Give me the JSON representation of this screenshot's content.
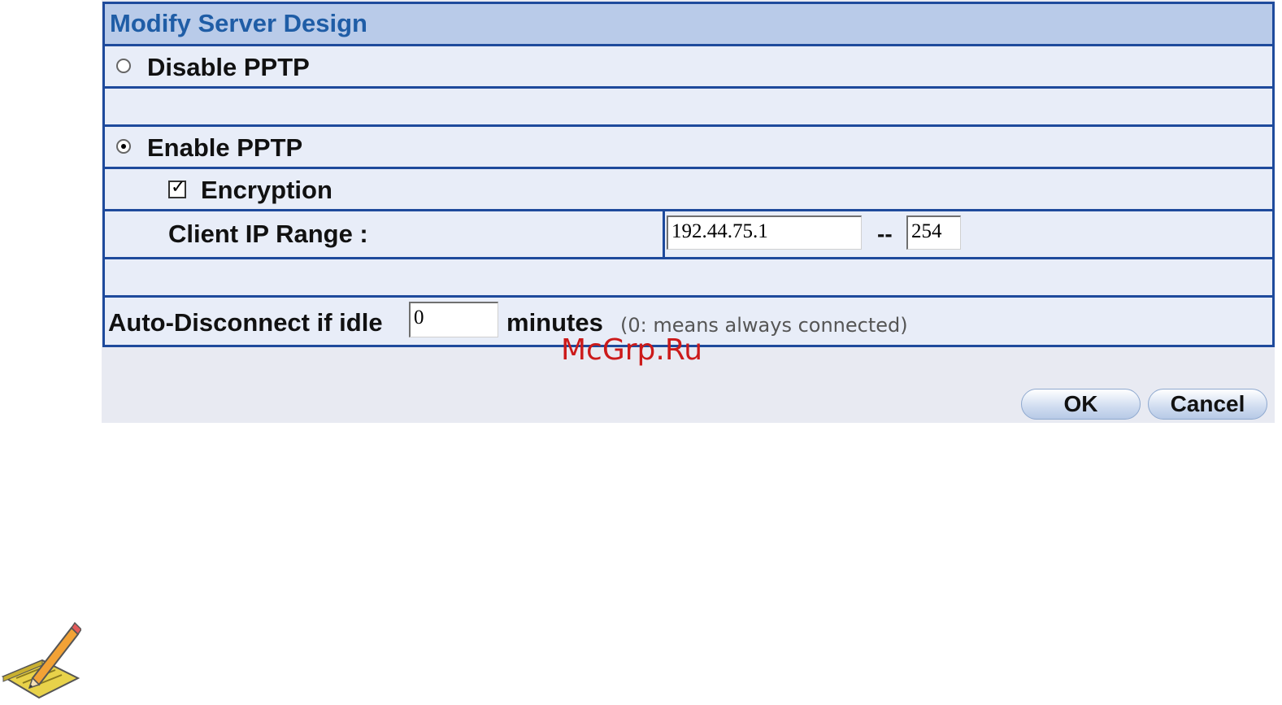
{
  "form": {
    "title": "Modify Server Design",
    "disable_pptp": {
      "label": "Disable PPTP",
      "selected": false
    },
    "enable_pptp": {
      "label": "Enable PPTP",
      "selected": true
    },
    "encryption": {
      "label": "Encryption",
      "checked": true
    },
    "client_ip_range": {
      "label": "Client IP Range :",
      "start_value": "192.44.75.1",
      "separator": "--",
      "end_value": "254"
    },
    "auto_disconnect": {
      "label": "Auto-Disconnect if idle",
      "value": "0",
      "unit": "minutes",
      "hint": "(0: means always connected)"
    }
  },
  "buttons": {
    "ok": "OK",
    "cancel": "Cancel"
  },
  "watermark": "McGrp.Ru",
  "icons": {
    "note": "note-pencil-icon"
  },
  "colors": {
    "border": "#1e4a9c",
    "title_bg": "#b9cbe9",
    "title_text": "#1f5da6",
    "row_bg": "#e8edf8"
  }
}
